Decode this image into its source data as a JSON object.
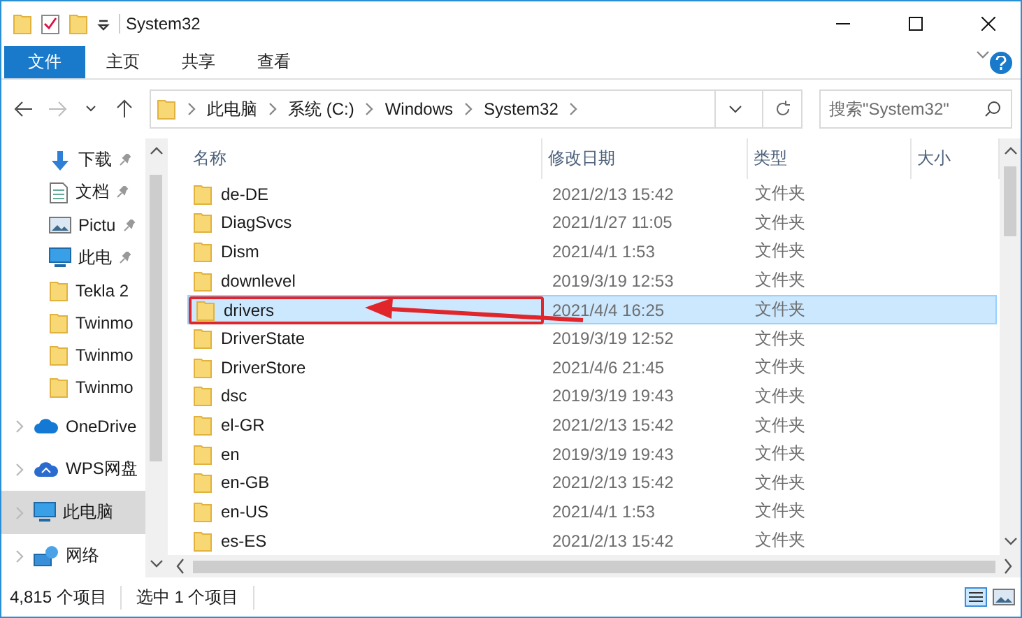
{
  "window": {
    "title": "System32"
  },
  "ribbon": {
    "tabs": [
      {
        "label": "文件",
        "kind": "file"
      },
      {
        "label": "主页",
        "kind": "tab"
      },
      {
        "label": "共享",
        "kind": "tab"
      },
      {
        "label": "查看",
        "kind": "tab"
      }
    ]
  },
  "address": {
    "crumbs": [
      "此电脑",
      "系统 (C:)",
      "Windows",
      "System32"
    ],
    "search": {
      "placeholder": "搜索\"System32\""
    }
  },
  "nav": [
    {
      "label": "下载",
      "kind": "download",
      "pinned": true,
      "selected": false,
      "expandable": false
    },
    {
      "label": "文档",
      "kind": "document",
      "pinned": true,
      "selected": false,
      "expandable": false
    },
    {
      "label": "Pictu",
      "kind": "picture",
      "pinned": true,
      "selected": false,
      "expandable": false
    },
    {
      "label": "此电",
      "kind": "computer",
      "pinned": true,
      "selected": false,
      "expandable": false
    },
    {
      "label": "Tekla 2",
      "kind": "folder",
      "pinned": false,
      "selected": false,
      "expandable": false
    },
    {
      "label": "Twinmo",
      "kind": "folder",
      "pinned": false,
      "selected": false,
      "expandable": false
    },
    {
      "label": "Twinmo",
      "kind": "folder",
      "pinned": false,
      "selected": false,
      "expandable": false
    },
    {
      "label": "Twinmo",
      "kind": "folder",
      "pinned": false,
      "selected": false,
      "expandable": false
    },
    {
      "label": "OneDrive",
      "kind": "cloud",
      "pinned": false,
      "selected": false,
      "expandable": true
    },
    {
      "label": "WPS网盘",
      "kind": "wps",
      "pinned": false,
      "selected": false,
      "expandable": true
    },
    {
      "label": "此电脑",
      "kind": "computer",
      "pinned": false,
      "selected": true,
      "expandable": true
    },
    {
      "label": "网络",
      "kind": "network",
      "pinned": false,
      "selected": false,
      "expandable": true
    }
  ],
  "table": {
    "columns": [
      "名称",
      "修改日期",
      "类型",
      "大小"
    ],
    "rows": [
      {
        "name": "de-DE",
        "date": "2021/2/13 15:42",
        "type": "文件夹",
        "selected": false,
        "annotated": false
      },
      {
        "name": "DiagSvcs",
        "date": "2021/1/27 11:05",
        "type": "文件夹",
        "selected": false,
        "annotated": false
      },
      {
        "name": "Dism",
        "date": "2021/4/1 1:53",
        "type": "文件夹",
        "selected": false,
        "annotated": false
      },
      {
        "name": "downlevel",
        "date": "2019/3/19 12:53",
        "type": "文件夹",
        "selected": false,
        "annotated": false
      },
      {
        "name": "drivers",
        "date": "2021/4/4 16:25",
        "type": "文件夹",
        "selected": true,
        "annotated": true
      },
      {
        "name": "DriverState",
        "date": "2019/3/19 12:52",
        "type": "文件夹",
        "selected": false,
        "annotated": false
      },
      {
        "name": "DriverStore",
        "date": "2021/4/6 21:45",
        "type": "文件夹",
        "selected": false,
        "annotated": false
      },
      {
        "name": "dsc",
        "date": "2019/3/19 19:43",
        "type": "文件夹",
        "selected": false,
        "annotated": false
      },
      {
        "name": "el-GR",
        "date": "2021/2/13 15:42",
        "type": "文件夹",
        "selected": false,
        "annotated": false
      },
      {
        "name": "en",
        "date": "2019/3/19 19:43",
        "type": "文件夹",
        "selected": false,
        "annotated": false
      },
      {
        "name": "en-GB",
        "date": "2021/2/13 15:42",
        "type": "文件夹",
        "selected": false,
        "annotated": false
      },
      {
        "name": "en-US",
        "date": "2021/4/1 1:53",
        "type": "文件夹",
        "selected": false,
        "annotated": false
      },
      {
        "name": "es-ES",
        "date": "2021/2/13 15:42",
        "type": "文件夹",
        "selected": false,
        "annotated": false
      }
    ]
  },
  "status_bar": {
    "count": "4,815 个项目",
    "selection": "选中 1 个项目"
  }
}
